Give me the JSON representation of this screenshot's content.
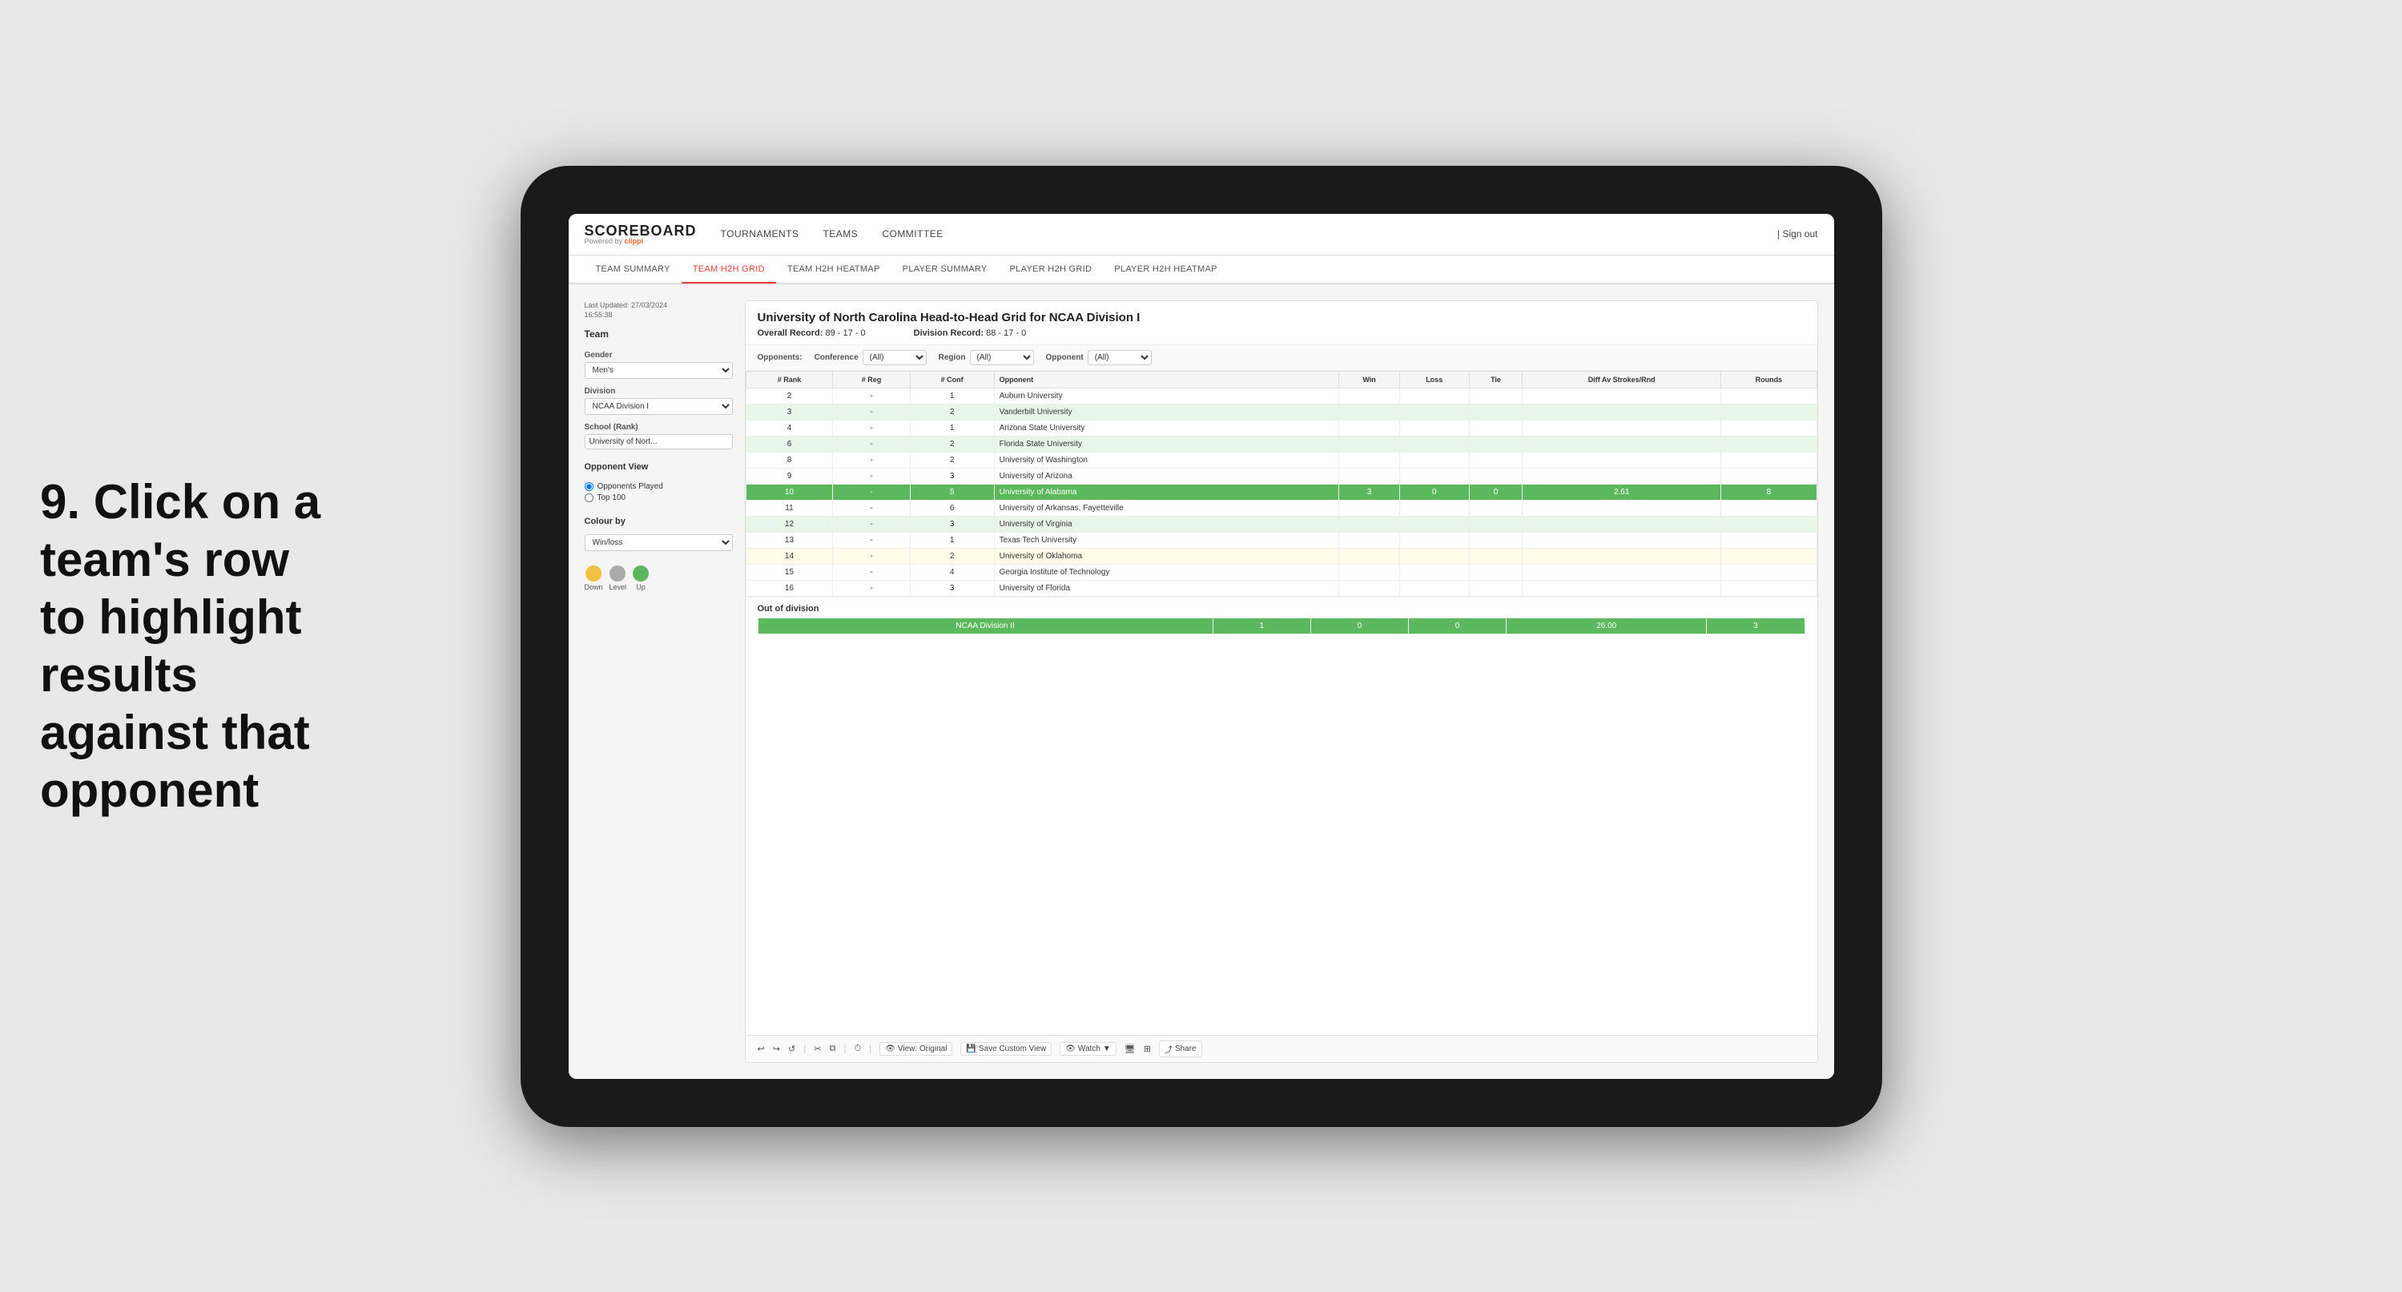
{
  "annotation": {
    "text": "9. Click on a team's row to highlight results against that opponent"
  },
  "logo": {
    "scoreboard": "SCOREBOARD",
    "powered_by": "Powered by",
    "brand": "clippi"
  },
  "nav": {
    "links": [
      "TOURNAMENTS",
      "TEAMS",
      "COMMITTEE"
    ],
    "sign_out": "Sign out"
  },
  "sub_nav": {
    "links": [
      "TEAM SUMMARY",
      "TEAM H2H GRID",
      "TEAM H2H HEATMAP",
      "PLAYER SUMMARY",
      "PLAYER H2H GRID",
      "PLAYER H2H HEATMAP"
    ],
    "active": "TEAM H2H GRID"
  },
  "left_panel": {
    "last_updated_label": "Last Updated: 27/03/2024",
    "last_updated_time": "16:55:38",
    "team_label": "Team",
    "gender_label": "Gender",
    "gender_value": "Men's",
    "division_label": "Division",
    "division_value": "NCAA Division I",
    "school_rank_label": "School (Rank)",
    "school_rank_value": "University of Nort...",
    "opponent_view_label": "Opponent View",
    "opponent_options": [
      "Opponents Played",
      "Top 100"
    ],
    "opponent_selected": "Opponents Played",
    "colour_by_label": "Colour by",
    "colour_by_value": "Win/loss",
    "legend": [
      {
        "color": "#f0c040",
        "label": "Down"
      },
      {
        "color": "#aaaaaa",
        "label": "Level"
      },
      {
        "color": "#5cb85c",
        "label": "Up"
      }
    ]
  },
  "grid": {
    "title": "University of North Carolina Head-to-Head Grid for NCAA Division I",
    "overall_record_label": "Overall Record:",
    "overall_record": "89 - 17 - 0",
    "division_record_label": "Division Record:",
    "division_record": "88 - 17 - 0",
    "filters": {
      "opponents_label": "Opponents:",
      "conference_label": "Conference",
      "conference_value": "(All)",
      "region_label": "Region",
      "region_value": "(All)",
      "opponent_label": "Opponent",
      "opponent_value": "(All)"
    },
    "columns": {
      "rank": "# Rank",
      "reg": "# Reg",
      "conf": "# Conf",
      "opponent": "Opponent",
      "win": "Win",
      "loss": "Loss",
      "tie": "Tie",
      "diff_av": "Diff Av Strokes/Rnd",
      "rounds": "Rounds"
    },
    "rows": [
      {
        "rank": "2",
        "reg": "-",
        "conf": "1",
        "opponent": "Auburn University",
        "win": "",
        "loss": "",
        "tie": "",
        "diff": "",
        "rounds": "",
        "style": "normal"
      },
      {
        "rank": "3",
        "reg": "-",
        "conf": "2",
        "opponent": "Vanderbilt University",
        "win": "",
        "loss": "",
        "tie": "",
        "diff": "",
        "rounds": "",
        "style": "light-green"
      },
      {
        "rank": "4",
        "reg": "-",
        "conf": "1",
        "opponent": "Arizona State University",
        "win": "",
        "loss": "",
        "tie": "",
        "diff": "",
        "rounds": "",
        "style": "normal"
      },
      {
        "rank": "6",
        "reg": "-",
        "conf": "2",
        "opponent": "Florida State University",
        "win": "",
        "loss": "",
        "tie": "",
        "diff": "",
        "rounds": "",
        "style": "light-green"
      },
      {
        "rank": "8",
        "reg": "-",
        "conf": "2",
        "opponent": "University of Washington",
        "win": "",
        "loss": "",
        "tie": "",
        "diff": "",
        "rounds": "",
        "style": "normal"
      },
      {
        "rank": "9",
        "reg": "-",
        "conf": "3",
        "opponent": "University of Arizona",
        "win": "",
        "loss": "",
        "tie": "",
        "diff": "",
        "rounds": "",
        "style": "normal"
      },
      {
        "rank": "10",
        "reg": "-",
        "conf": "5",
        "opponent": "University of Alabama",
        "win": "3",
        "loss": "0",
        "tie": "0",
        "diff": "2.61",
        "rounds": "8",
        "style": "highlighted"
      },
      {
        "rank": "11",
        "reg": "-",
        "conf": "6",
        "opponent": "University of Arkansas, Fayetteville",
        "win": "",
        "loss": "",
        "tie": "",
        "diff": "",
        "rounds": "",
        "style": "normal"
      },
      {
        "rank": "12",
        "reg": "-",
        "conf": "3",
        "opponent": "University of Virginia",
        "win": "",
        "loss": "",
        "tie": "",
        "diff": "",
        "rounds": "",
        "style": "light-green"
      },
      {
        "rank": "13",
        "reg": "-",
        "conf": "1",
        "opponent": "Texas Tech University",
        "win": "",
        "loss": "",
        "tie": "",
        "diff": "",
        "rounds": "",
        "style": "normal"
      },
      {
        "rank": "14",
        "reg": "-",
        "conf": "2",
        "opponent": "University of Oklahoma",
        "win": "",
        "loss": "",
        "tie": "",
        "diff": "",
        "rounds": "",
        "style": "light-yellow"
      },
      {
        "rank": "15",
        "reg": "-",
        "conf": "4",
        "opponent": "Georgia Institute of Technology",
        "win": "",
        "loss": "",
        "tie": "",
        "diff": "",
        "rounds": "",
        "style": "normal"
      },
      {
        "rank": "16",
        "reg": "-",
        "conf": "3",
        "opponent": "University of Florida",
        "win": "",
        "loss": "",
        "tie": "",
        "diff": "",
        "rounds": "",
        "style": "normal"
      }
    ],
    "out_of_division": {
      "label": "Out of division",
      "division": "NCAA Division II",
      "win": "1",
      "loss": "0",
      "tie": "0",
      "diff": "26.00",
      "rounds": "3"
    }
  },
  "toolbar": {
    "view_original": "View: Original",
    "save_custom": "Save Custom View",
    "watch": "Watch",
    "share": "Share"
  }
}
